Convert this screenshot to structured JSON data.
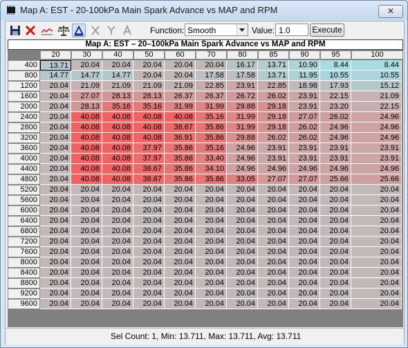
{
  "window": {
    "title": "Map A: EST - 20-100kPa Main Spark Advance vs MAP and RPM",
    "close_label": "✕"
  },
  "toolbar": {
    "icons": [
      "save-icon",
      "delete-icon",
      "graph-icon",
      "balance-icon",
      "delta-icon",
      "x-icon",
      "y-icon",
      "a-icon"
    ],
    "function_label": "Function:",
    "function_value": "Smooth",
    "value_label": "Value:",
    "value": "1.0",
    "execute_label": "Execute"
  },
  "grid": {
    "title": "Map A: EST – 20–100kPa Main Spark Advance vs MAP and RPM",
    "columns": [
      "20",
      "30",
      "40",
      "50",
      "60",
      "70",
      "80",
      "85",
      "90",
      "95",
      "100"
    ],
    "rows": [
      "400",
      "800",
      "1200",
      "1600",
      "2000",
      "2400",
      "2800",
      "3200",
      "3600",
      "4000",
      "4400",
      "4800",
      "5200",
      "5600",
      "6000",
      "6400",
      "6800",
      "7200",
      "7600",
      "8000",
      "8400",
      "8800",
      "9200",
      "9600"
    ],
    "values": [
      [
        "13.71",
        "20.04",
        "20.04",
        "20.04",
        "20.04",
        "20.04",
        "16.17",
        "13.71",
        "10.90",
        "8.44",
        "8.44"
      ],
      [
        "14.77",
        "14.77",
        "14.77",
        "20.04",
        "20.04",
        "17.58",
        "17.58",
        "13.71",
        "11.95",
        "10.55",
        "10.55"
      ],
      [
        "20.04",
        "21.09",
        "21.09",
        "21.09",
        "21.09",
        "22.85",
        "23.91",
        "22.85",
        "18.98",
        "17.93",
        "15.12"
      ],
      [
        "20.04",
        "27.07",
        "28.13",
        "28.13",
        "26.37",
        "26.37",
        "26.72",
        "26.02",
        "23.91",
        "22.15",
        "21.09"
      ],
      [
        "20.04",
        "28.13",
        "35.16",
        "35.16",
        "31.99",
        "31.99",
        "29.88",
        "29.18",
        "23.91",
        "23.20",
        "22.15"
      ],
      [
        "20.04",
        "40.08",
        "40.08",
        "40.08",
        "40.08",
        "35.16",
        "31.99",
        "29.18",
        "27.07",
        "26.02",
        "24.96"
      ],
      [
        "20.04",
        "40.08",
        "40.08",
        "40.08",
        "38.67",
        "35.86",
        "31.99",
        "29.18",
        "26.02",
        "24.96",
        "24.96"
      ],
      [
        "20.04",
        "40.08",
        "40.08",
        "40.08",
        "36.91",
        "35.86",
        "29.88",
        "26.02",
        "26.02",
        "24.96",
        "24.96"
      ],
      [
        "20.04",
        "40.08",
        "40.08",
        "37.97",
        "35.86",
        "35.16",
        "24.96",
        "23.91",
        "23.91",
        "23.91",
        "23.91"
      ],
      [
        "20.04",
        "40.08",
        "40.08",
        "37.97",
        "35.86",
        "33.40",
        "24.96",
        "23.91",
        "23.91",
        "23.91",
        "23.91"
      ],
      [
        "20.04",
        "40.08",
        "40.08",
        "38.67",
        "35.86",
        "34.10",
        "24.96",
        "24.96",
        "24.96",
        "24.96",
        "24.96"
      ],
      [
        "20.04",
        "40.08",
        "40.08",
        "38.67",
        "35.86",
        "35.86",
        "33.05",
        "27.07",
        "27.07",
        "25.66",
        "25.66"
      ],
      [
        "20.04",
        "20.04",
        "20.04",
        "20.04",
        "20.04",
        "20.04",
        "20.04",
        "20.04",
        "20.04",
        "20.04",
        "20.04"
      ],
      [
        "20.04",
        "20.04",
        "20.04",
        "20.04",
        "20.04",
        "20.04",
        "20.04",
        "20.04",
        "20.04",
        "20.04",
        "20.04"
      ],
      [
        "20.04",
        "20.04",
        "20.04",
        "20.04",
        "20.04",
        "20.04",
        "20.04",
        "20.04",
        "20.04",
        "20.04",
        "20.04"
      ],
      [
        "20.04",
        "20.04",
        "20.04",
        "20.04",
        "20.04",
        "20.04",
        "20.04",
        "20.04",
        "20.04",
        "20.04",
        "20.04"
      ],
      [
        "20.04",
        "20.04",
        "20.04",
        "20.04",
        "20.04",
        "20.04",
        "20.04",
        "20.04",
        "20.04",
        "20.04",
        "20.04"
      ],
      [
        "20.04",
        "20.04",
        "20.04",
        "20.04",
        "20.04",
        "20.04",
        "20.04",
        "20.04",
        "20.04",
        "20.04",
        "20.04"
      ],
      [
        "20.04",
        "20.04",
        "20.04",
        "20.04",
        "20.04",
        "20.04",
        "20.04",
        "20.04",
        "20.04",
        "20.04",
        "20.04"
      ],
      [
        "20.04",
        "20.04",
        "20.04",
        "20.04",
        "20.04",
        "20.04",
        "20.04",
        "20.04",
        "20.04",
        "20.04",
        "20.04"
      ],
      [
        "20.04",
        "20.04",
        "20.04",
        "20.04",
        "20.04",
        "20.04",
        "20.04",
        "20.04",
        "20.04",
        "20.04",
        "20.04"
      ],
      [
        "20.04",
        "20.04",
        "20.04",
        "20.04",
        "20.04",
        "20.04",
        "20.04",
        "20.04",
        "20.04",
        "20.04",
        "20.04"
      ],
      [
        "20.04",
        "20.04",
        "20.04",
        "20.04",
        "20.04",
        "20.04",
        "20.04",
        "20.04",
        "20.04",
        "20.04",
        "20.04"
      ],
      [
        "20.04",
        "20.04",
        "20.04",
        "20.04",
        "20.04",
        "20.04",
        "20.04",
        "20.04",
        "20.04",
        "20.04",
        "20.04"
      ]
    ],
    "selected": [
      0,
      0
    ],
    "colors": {
      "low": "#a6dce2",
      "mid": "#c2b8b8",
      "high": "#f26262",
      "selected": "#b8c6d2"
    }
  },
  "status": {
    "text": "Sel Count: 1, Min: 13.711, Max: 13.711, Avg: 13.711"
  }
}
